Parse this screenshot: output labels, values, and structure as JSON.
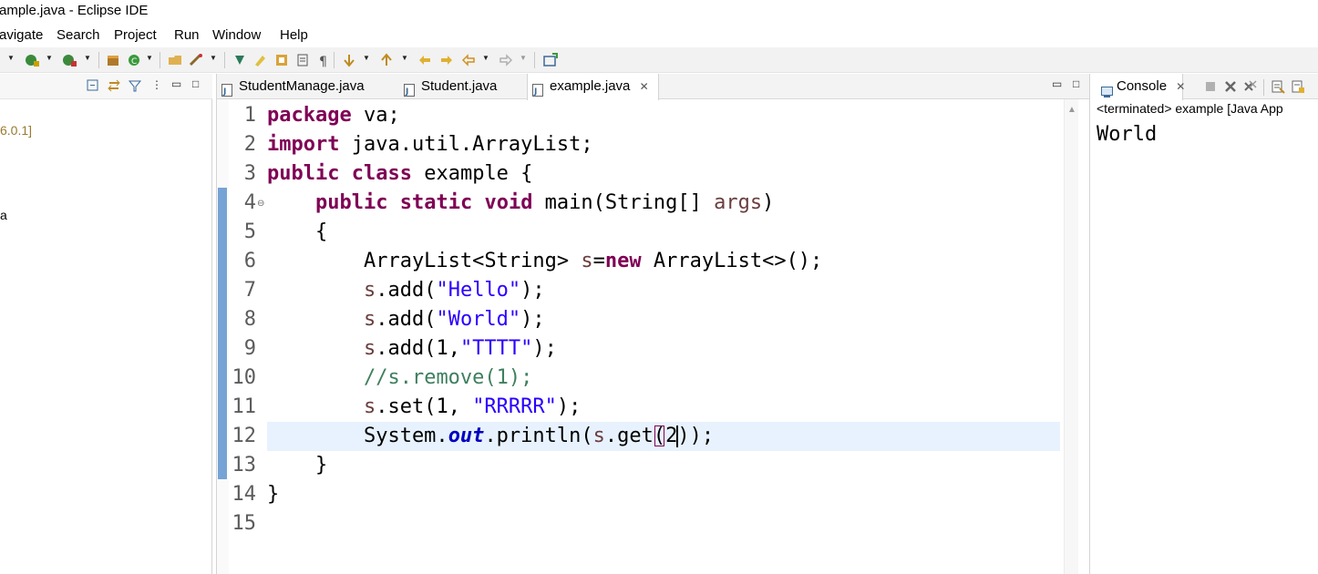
{
  "window": {
    "title": "ample.java - Eclipse IDE"
  },
  "menu": [
    "avigate",
    "Search",
    "Project",
    "Run",
    "Window",
    "Help"
  ],
  "left_panel": {
    "tree_lines": [
      "6.0.1]",
      "a"
    ]
  },
  "editor": {
    "tabs": [
      {
        "label": "StudentManage.java",
        "active": false
      },
      {
        "label": "Student.java",
        "active": false
      },
      {
        "label": "example.java",
        "active": true
      }
    ],
    "line_numbers": [
      "1",
      "2",
      "3",
      "4",
      "5",
      "6",
      "7",
      "8",
      "9",
      "10",
      "11",
      "12",
      "13",
      "14",
      "15"
    ],
    "current_line": 12,
    "code_tokens": {
      "l1_kw": "package",
      "l1_rest": " va;",
      "l2_kw": "import",
      "l2_rest": " java.util.ArrayList;",
      "l3_kw1": "public",
      "l3_kw2": "class",
      "l3_rest": " example {",
      "l4_indent": "    ",
      "l4_kw1": "public",
      "l4_kw2": "static",
      "l4_kw3": "void",
      "l4_mid": " main(String[] ",
      "l4_var": "args",
      "l4_end": ")",
      "l5": "    {",
      "l6_a": "        ArrayList<String> ",
      "l6_var": "s",
      "l6_eq": "=",
      "l6_kw": "new",
      "l6_end": " ArrayList<>();",
      "l7_indent": "        ",
      "l7_var": "s",
      "l7_a": ".add(",
      "l7_str": "\"Hello\"",
      "l7_end": ");",
      "l8_indent": "        ",
      "l8_var": "s",
      "l8_a": ".add(",
      "l8_str": "\"World\"",
      "l8_end": ");",
      "l9_indent": "        ",
      "l9_var": "s",
      "l9_a": ".add(1,",
      "l9_str": "\"TTTT\"",
      "l9_end": ");",
      "l10_indent": "        ",
      "l10_cmt": "//s.remove(1);",
      "l11_indent": "        ",
      "l11_var": "s",
      "l11_a": ".set(1, ",
      "l11_str": "\"RRRRR\"",
      "l11_end": ");",
      "l12_a": "        System.",
      "l12_fld": "out",
      "l12_b": ".println(",
      "l12_var": "s",
      "l12_c": ".get",
      "l12_paren_open": "(",
      "l12_arg": "2",
      "l12_paren_close": ")",
      "l12_end": ");",
      "l13": "    }",
      "l14": "}",
      "l15": ""
    }
  },
  "console": {
    "tab_label": "Console",
    "status": "<terminated> example [Java App",
    "output": "World"
  }
}
